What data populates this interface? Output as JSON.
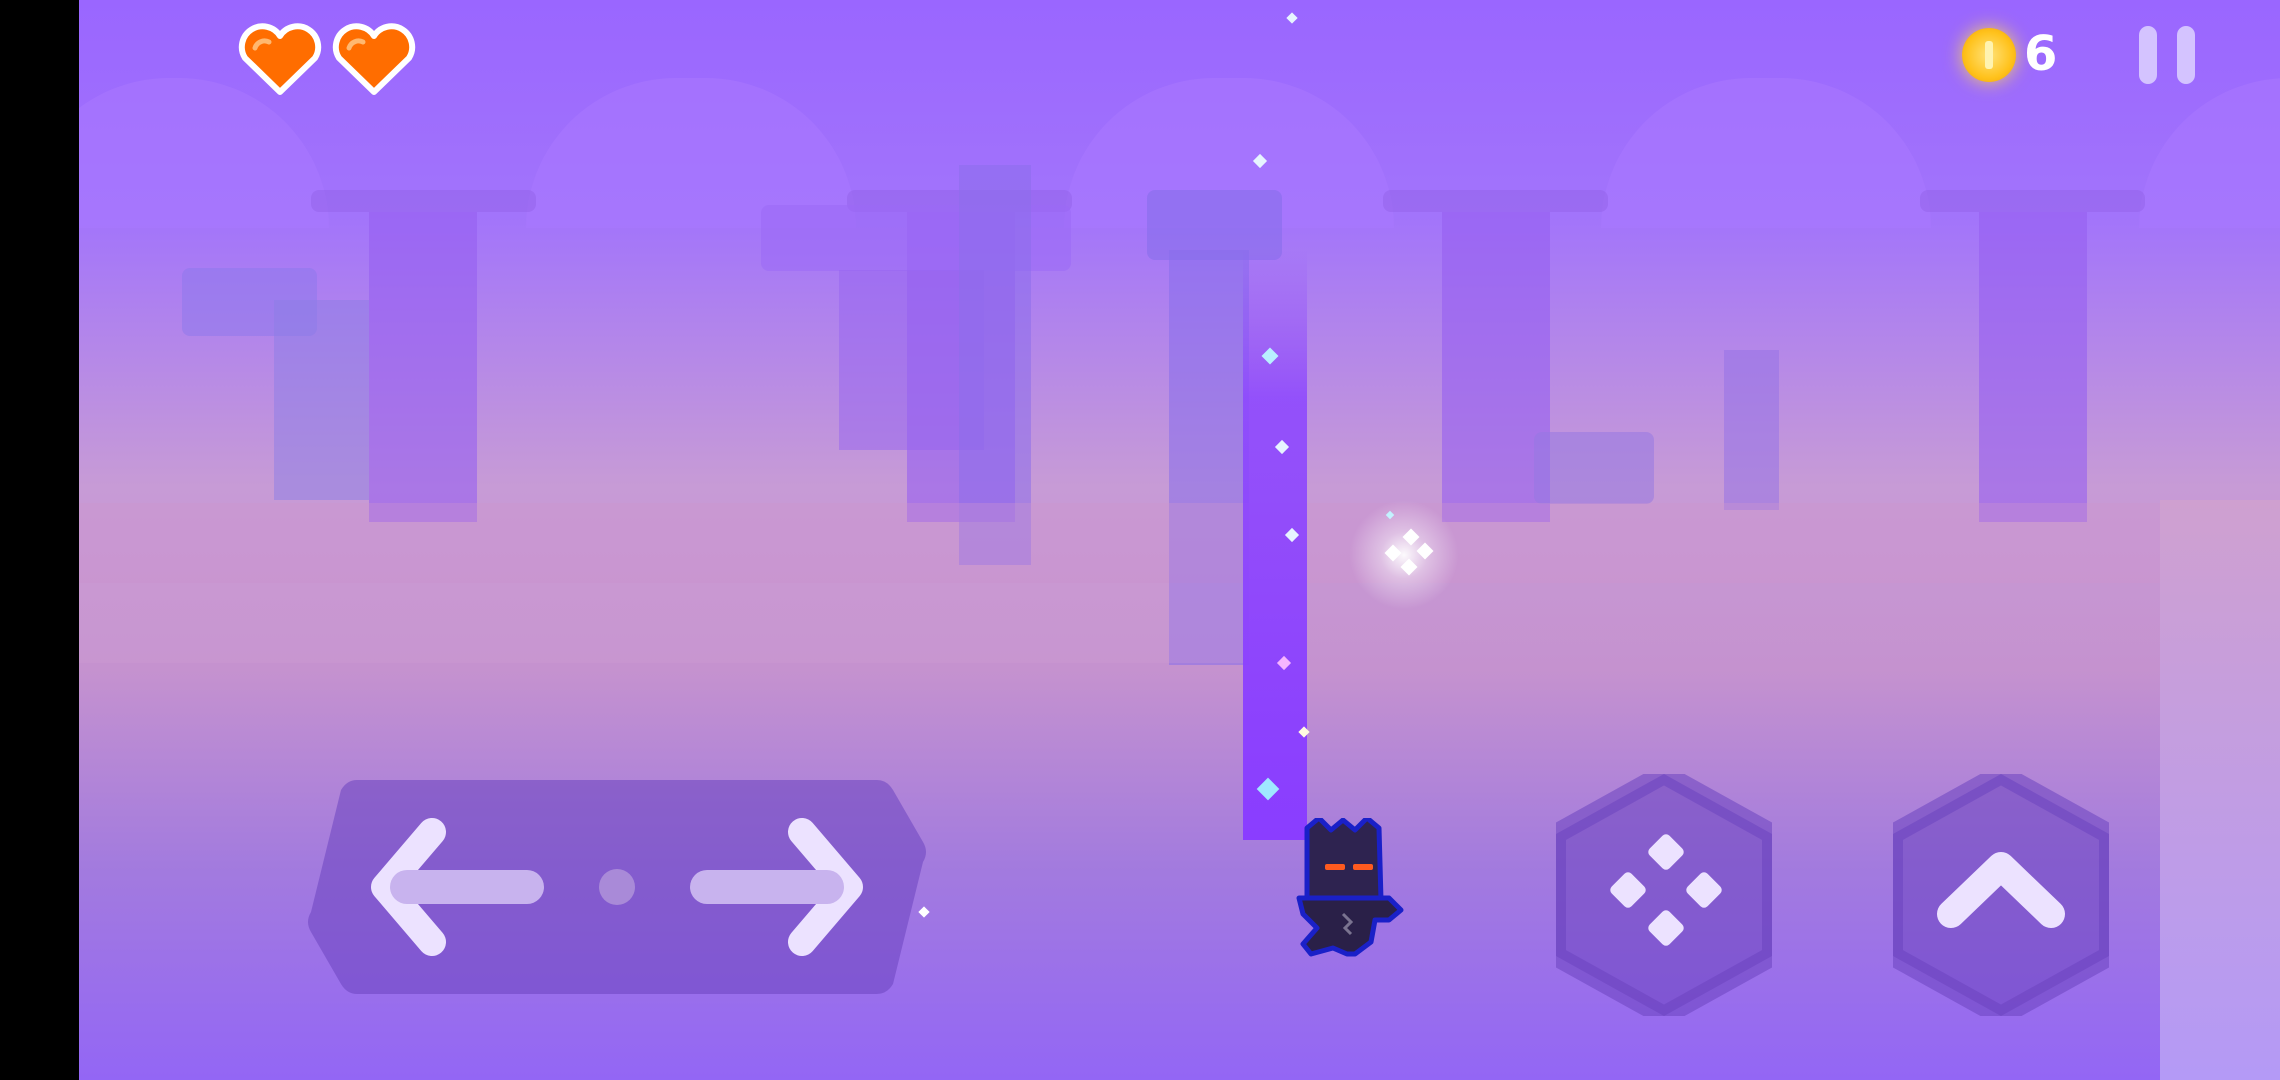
{
  "hud": {
    "lives": 2,
    "hearts": [
      {
        "name": "heart-1",
        "color": "#ff6d00"
      },
      {
        "name": "heart-2",
        "color": "#ff6d00"
      }
    ],
    "coin_count": "6",
    "coin_icon": "gold-coin-icon",
    "pause_icon": "pause-icon"
  },
  "controls": {
    "left_icon": "arrow-left-icon",
    "right_icon": "arrow-right-icon",
    "dash_icon": "four-diamond-icon",
    "jump_icon": "chevron-up-icon",
    "button_color": "#6b43c0"
  },
  "colors": {
    "sky_top": "#9a66ff",
    "mist": "#c79bd6",
    "beam": "#8a3dff",
    "heart": "#ff6d00",
    "coin": "#ffc21c"
  }
}
